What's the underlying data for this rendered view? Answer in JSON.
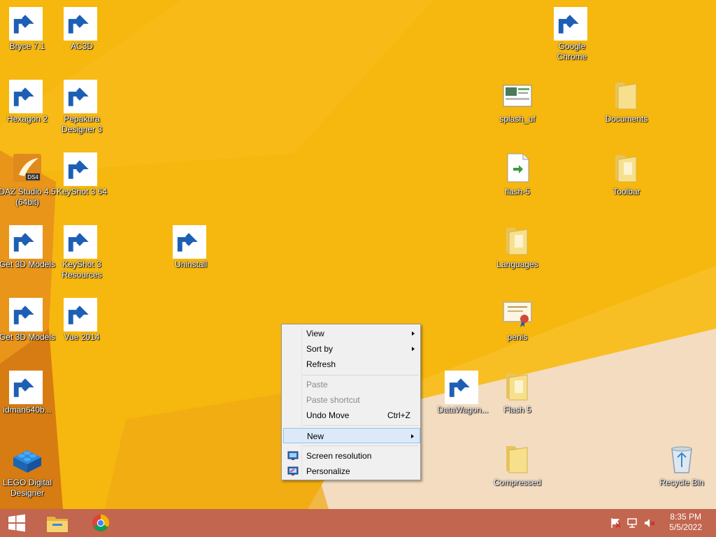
{
  "desktop": {
    "icons": [
      {
        "label": "Bryce 7.1",
        "icon": "bryce-icon"
      },
      {
        "label": "AC3D",
        "icon": "ac3d-icon"
      },
      {
        "label": "Google Chrome",
        "icon": "chrome-icon"
      },
      {
        "label": "Hexagon 2",
        "icon": "hexagon-icon"
      },
      {
        "label": "Pepakura Designer 3",
        "icon": "pepakura-icon"
      },
      {
        "label": "splash_uf",
        "icon": "image-file-icon"
      },
      {
        "label": "Documents",
        "icon": "folder-icon"
      },
      {
        "label": "DAZ Studio 4.5 (64bit)",
        "icon": "daz-studio-icon"
      },
      {
        "label": "KeyShot 3 64",
        "icon": "keyshot-icon"
      },
      {
        "label": "flash-5",
        "icon": "document-file-icon"
      },
      {
        "label": "Toolbar",
        "icon": "folder-icon"
      },
      {
        "label": "Get 3D Models",
        "icon": "daz-store-icon"
      },
      {
        "label": "KeyShot 3 Resources",
        "icon": "folder-icon"
      },
      {
        "label": "Uninstall",
        "icon": "installer-icon"
      },
      {
        "label": "Languages",
        "icon": "folder-icon"
      },
      {
        "label": "Get 3D Models",
        "icon": "daz-store-icon"
      },
      {
        "label": "Vue 2014",
        "icon": "vue-icon"
      },
      {
        "label": "penis",
        "icon": "certificate-icon"
      },
      {
        "label": "idman640b...",
        "icon": "installer-icon"
      },
      {
        "label": "DataWagon...",
        "icon": "datawagon-icon"
      },
      {
        "label": "Flash 5",
        "icon": "folder-icon"
      },
      {
        "label": "LEGO Digital Designer",
        "icon": "lego-icon"
      },
      {
        "label": "Compressed",
        "icon": "folder-icon"
      },
      {
        "label": "Recycle Bin",
        "icon": "recycle-bin-icon"
      }
    ]
  },
  "context_menu": {
    "items": [
      {
        "label": "View",
        "submenu": true
      },
      {
        "label": "Sort by",
        "submenu": true
      },
      {
        "label": "Refresh"
      },
      {
        "label": "Paste",
        "disabled": true
      },
      {
        "label": "Paste shortcut",
        "disabled": true
      },
      {
        "label": "Undo Move",
        "shortcut": "Ctrl+Z"
      },
      {
        "label": "New",
        "submenu": true,
        "highlighted": true
      },
      {
        "label": "Screen resolution",
        "icon": "screen-resolution-icon"
      },
      {
        "label": "Personalize",
        "icon": "personalize-icon"
      }
    ]
  },
  "taskbar": {
    "pinned": [
      "start-button",
      "file-explorer",
      "google-chrome"
    ],
    "tray_icons": [
      "action-center-flag-icon",
      "network-icon",
      "volume-muted-icon"
    ],
    "clock": {
      "time": "8:35 PM",
      "date": "5/5/2022"
    }
  },
  "colors": {
    "background": "#f6b70f",
    "taskbar": "#c2664f",
    "menu_highlight": "#dbe9f8"
  }
}
